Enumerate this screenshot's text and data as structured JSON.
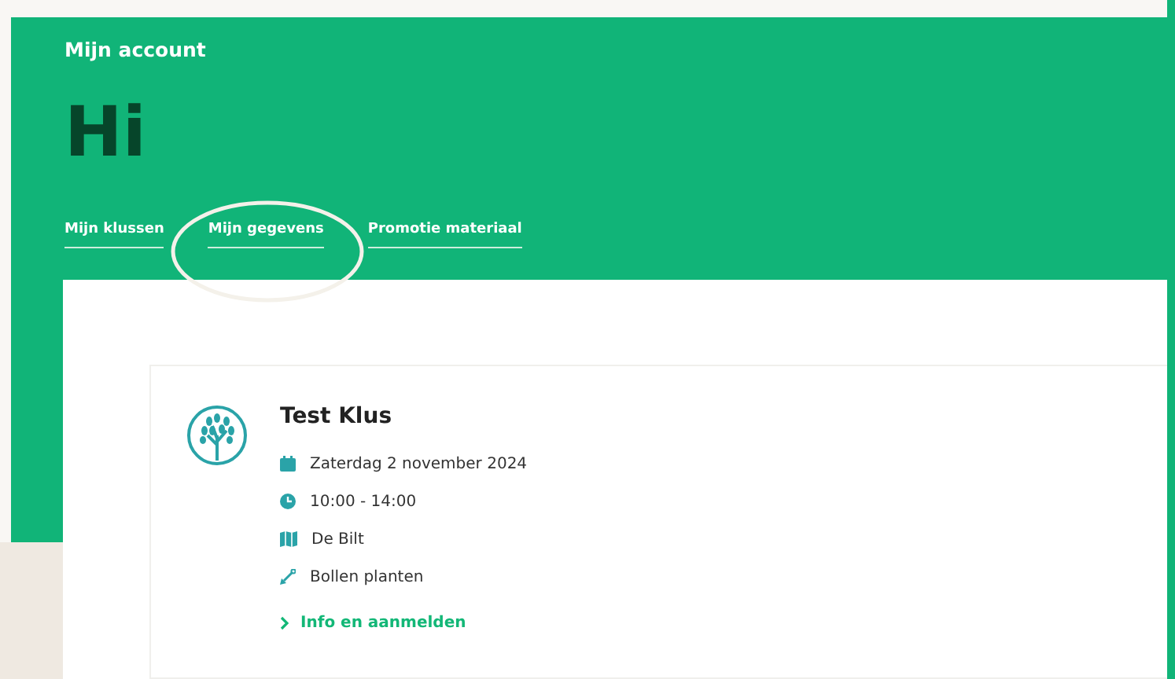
{
  "header": {
    "subtitle": "Mijn account",
    "greeting": "Hi"
  },
  "tabs": [
    {
      "label": "Mijn klussen"
    },
    {
      "label": "Mijn gegevens"
    },
    {
      "label": "Promotie materiaal"
    }
  ],
  "jobs": [
    {
      "title": "Test Klus",
      "details": [
        {
          "kind": "date",
          "text": "Zaterdag 2 november 2024"
        },
        {
          "kind": "time",
          "text": "10:00 - 14:00"
        },
        {
          "kind": "place",
          "text": "De Bilt"
        },
        {
          "kind": "task",
          "text": "Bollen planten"
        }
      ],
      "link": "Info en aanmelden"
    }
  ]
}
